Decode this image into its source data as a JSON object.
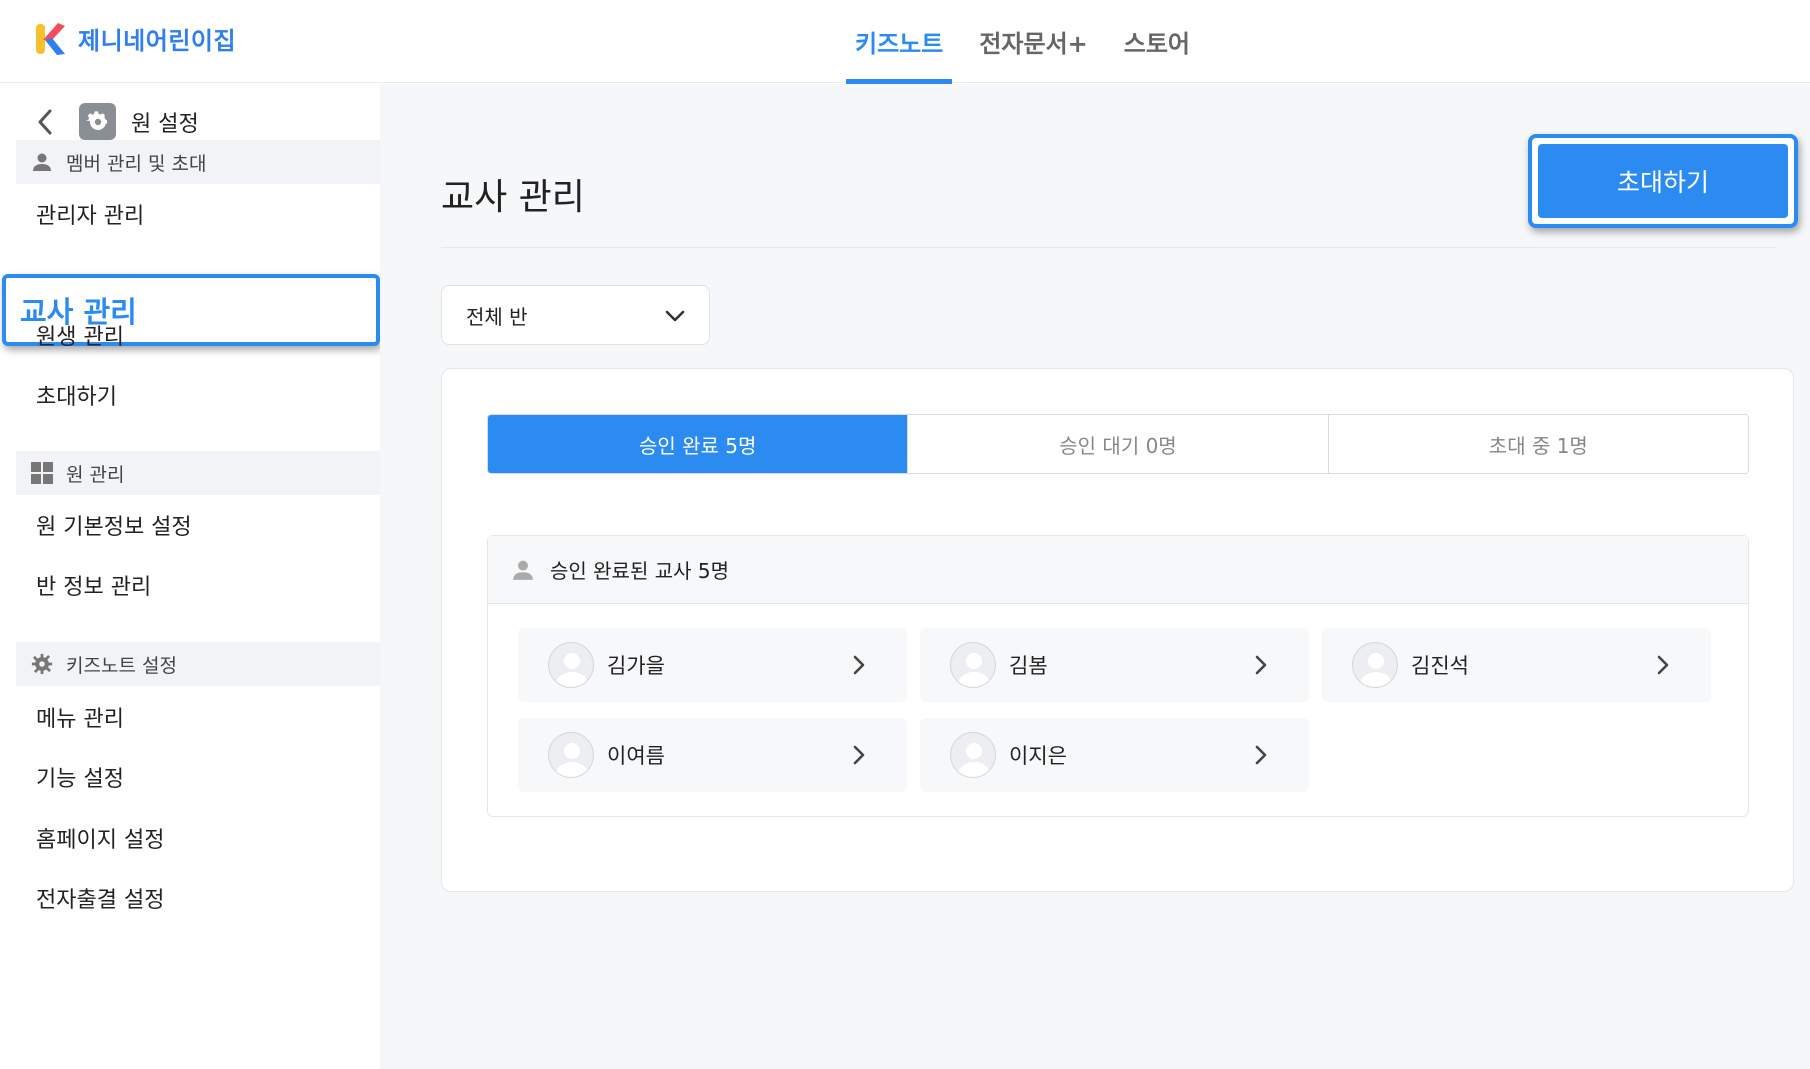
{
  "brand": {
    "name": "제니네어린이집"
  },
  "nav": {
    "tabs": [
      "키즈노트",
      "전자문서+",
      "스토어"
    ]
  },
  "sidebar": {
    "title": "원 설정",
    "sections": [
      {
        "label": "멤버 관리 및 초대",
        "items": [
          "관리자 관리",
          "교사 관리",
          "원생 관리",
          "초대하기"
        ]
      },
      {
        "label": "원 관리",
        "items": [
          "원 기본정보 설정",
          "반 정보 관리"
        ]
      },
      {
        "label": "키즈노트 설정",
        "items": [
          "메뉴 관리",
          "기능 설정",
          "홈페이지 설정",
          "전자출결 설정"
        ]
      }
    ],
    "active_item": "교사 관리"
  },
  "main": {
    "title": "교사 관리",
    "invite_button": "초대하기",
    "class_filter": "전체 반",
    "status_tabs": [
      "승인 완료 5명",
      "승인 대기 0명",
      "초대 중 1명"
    ],
    "active_tab": "승인 완료 5명",
    "list_header": "승인 완료된 교사 5명",
    "teachers": [
      "김가을",
      "김봄",
      "김진석",
      "이여름",
      "이지은"
    ]
  },
  "colors": {
    "accent": "#2b8bf0",
    "brand": "#2f80ed"
  }
}
